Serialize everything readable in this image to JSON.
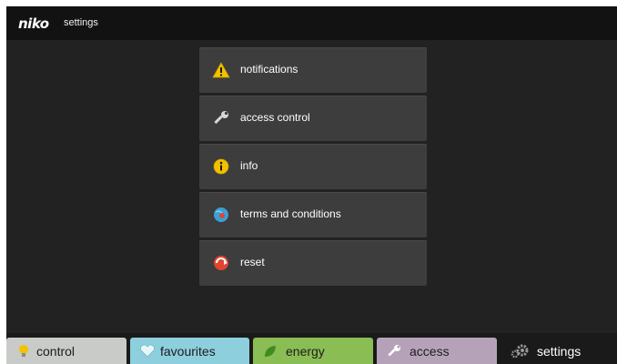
{
  "header": {
    "brand": "niko",
    "title": "settings"
  },
  "menu": {
    "items": [
      {
        "label": "notifications",
        "icon": "warning-icon"
      },
      {
        "label": "access control",
        "icon": "wrench-icon"
      },
      {
        "label": "info",
        "icon": "info-icon"
      },
      {
        "label": "terms and conditions",
        "icon": "globe-icon"
      },
      {
        "label": "reset",
        "icon": "reset-icon"
      }
    ]
  },
  "tabs": [
    {
      "label": "control",
      "icon": "bulb-icon",
      "color": "#c9cbc9"
    },
    {
      "label": "favourites",
      "icon": "heart-icon",
      "color": "#8ecfde"
    },
    {
      "label": "energy",
      "icon": "leaf-icon",
      "color": "#8bbd55"
    },
    {
      "label": "access",
      "icon": "wrench-icon",
      "color": "#b6a2b8"
    },
    {
      "label": "settings",
      "icon": "gears-icon",
      "color": "#1a1a1a",
      "active": true
    }
  ]
}
